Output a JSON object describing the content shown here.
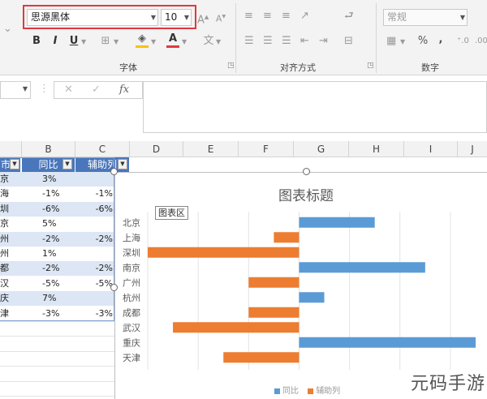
{
  "ribbon": {
    "font_name": "思源黑体",
    "font_size": "10",
    "bold": "B",
    "italic": "I",
    "underline": "U",
    "font_group_label": "字体",
    "alignment_group_label": "对齐方式",
    "number_group_label": "数字",
    "number_format": "常规",
    "percent_symbol": "%",
    "comma_symbol": ","
  },
  "formula_bar": {
    "cancel": "✕",
    "enter": "✓",
    "fx": "fx"
  },
  "columns": [
    "B",
    "C",
    "D",
    "E",
    "F",
    "G",
    "H",
    "I",
    "J"
  ],
  "table": {
    "header_a": "市",
    "header_b": "同比",
    "header_c": "辅助列",
    "rows": [
      {
        "a": "京",
        "b": "3%",
        "c": ""
      },
      {
        "a": "海",
        "b": "-1%",
        "c": "-1%"
      },
      {
        "a": "圳",
        "b": "-6%",
        "c": "-6%"
      },
      {
        "a": "京",
        "b": "5%",
        "c": ""
      },
      {
        "a": "州",
        "b": "-2%",
        "c": "-2%"
      },
      {
        "a": "州",
        "b": "1%",
        "c": ""
      },
      {
        "a": "都",
        "b": "-2%",
        "c": "-2%"
      },
      {
        "a": "汉",
        "b": "-5%",
        "c": "-5%"
      },
      {
        "a": "庆",
        "b": "7%",
        "c": ""
      },
      {
        "a": "津",
        "b": "-3%",
        "c": "-3%"
      }
    ]
  },
  "chart_tooltip": "图表区",
  "chart_data": {
    "type": "bar",
    "orientation": "horizontal",
    "title": "图表标题",
    "categories": [
      "北京",
      "上海",
      "深圳",
      "南京",
      "广州",
      "杭州",
      "成都",
      "武汉",
      "重庆",
      "天津"
    ],
    "series": [
      {
        "name": "同比",
        "color": "#5b9bd5",
        "values": [
          0.03,
          null,
          null,
          0.05,
          null,
          0.01,
          null,
          null,
          0.07,
          null
        ]
      },
      {
        "name": "辅助列",
        "color": "#ed7d31",
        "values": [
          null,
          -0.01,
          -0.06,
          null,
          -0.02,
          null,
          -0.02,
          -0.05,
          null,
          -0.03
        ]
      }
    ],
    "xlim": [
      -0.06,
      0.07
    ],
    "grid": true,
    "legend": "bottom"
  },
  "watermark": "元码手游网"
}
